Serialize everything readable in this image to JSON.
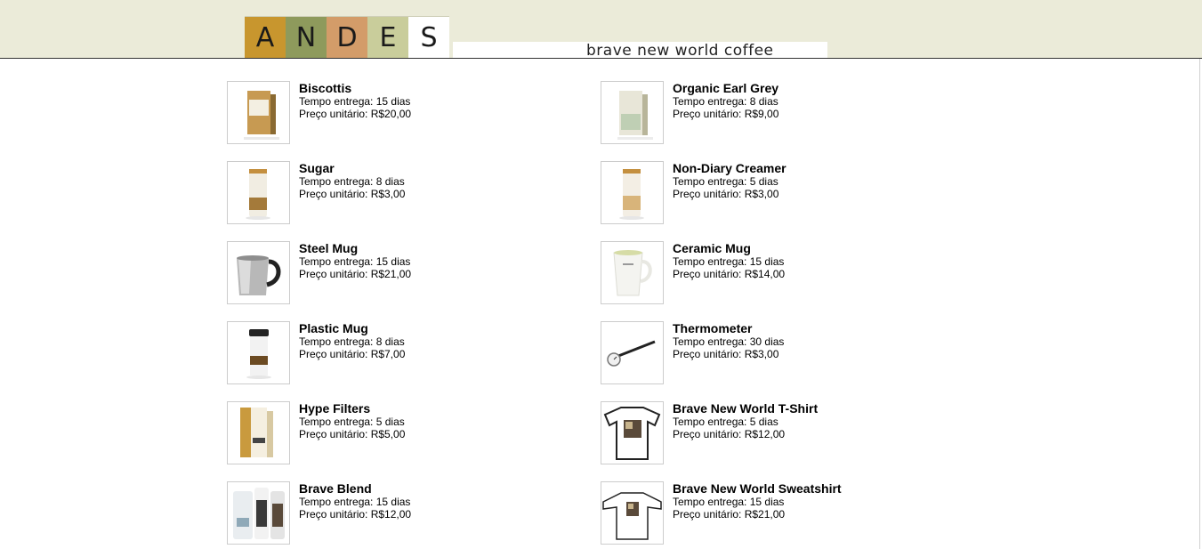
{
  "header": {
    "logo_letters": [
      "A",
      "N",
      "D",
      "E",
      "S"
    ],
    "logo_colors": [
      "#c8962e",
      "#8e9a5c",
      "#d39c69",
      "#c9cd9b",
      "#ffffff"
    ],
    "tagline": "brave new world coffee",
    "background": "#ebebd9"
  },
  "products": [
    {
      "name": "Biscottis",
      "delivery": "Tempo entrega: 15 dias",
      "price": "Preço unitário: R$20,00",
      "icon": "biscotti-box-image"
    },
    {
      "name": "Organic Earl Grey",
      "delivery": "Tempo entrega: 8 dias",
      "price": "Preço unitário: R$9,00",
      "icon": "tea-box-image"
    },
    {
      "name": "Sugar",
      "delivery": "Tempo entrega: 8 dias",
      "price": "Preço unitário: R$3,00",
      "icon": "sugar-canister-image"
    },
    {
      "name": "Non-Diary Creamer",
      "delivery": "Tempo entrega: 5 dias",
      "price": "Preço unitário: R$3,00",
      "icon": "creamer-canister-image"
    },
    {
      "name": "Steel Mug",
      "delivery": "Tempo entrega: 15 dias",
      "price": "Preço unitário: R$21,00",
      "icon": "steel-mug-image"
    },
    {
      "name": "Ceramic Mug",
      "delivery": "Tempo entrega: 15 dias",
      "price": "Preço unitário: R$14,00",
      "icon": "ceramic-mug-image"
    },
    {
      "name": "Plastic Mug",
      "delivery": "Tempo entrega: 8 dias",
      "price": "Preço unitário: R$7,00",
      "icon": "plastic-mug-image"
    },
    {
      "name": "Thermometer",
      "delivery": "Tempo entrega: 30 dias",
      "price": "Preço unitário: R$3,00",
      "icon": "thermometer-image"
    },
    {
      "name": "Hype Filters",
      "delivery": "Tempo entrega: 5 dias",
      "price": "Preço unitário: R$5,00",
      "icon": "filters-box-image"
    },
    {
      "name": "Brave New World T-Shirt",
      "delivery": "Tempo entrega: 5 dias",
      "price": "Preço unitário: R$12,00",
      "icon": "tshirt-image"
    },
    {
      "name": "Brave Blend",
      "delivery": "Tempo entrega: 15 dias",
      "price": "Preço unitário: R$12,00",
      "icon": "coffee-cans-image"
    },
    {
      "name": "Brave New World Sweatshirt",
      "delivery": "Tempo entrega: 15 dias",
      "price": "Preço unitário: R$21,00",
      "icon": "sweatshirt-image"
    }
  ]
}
